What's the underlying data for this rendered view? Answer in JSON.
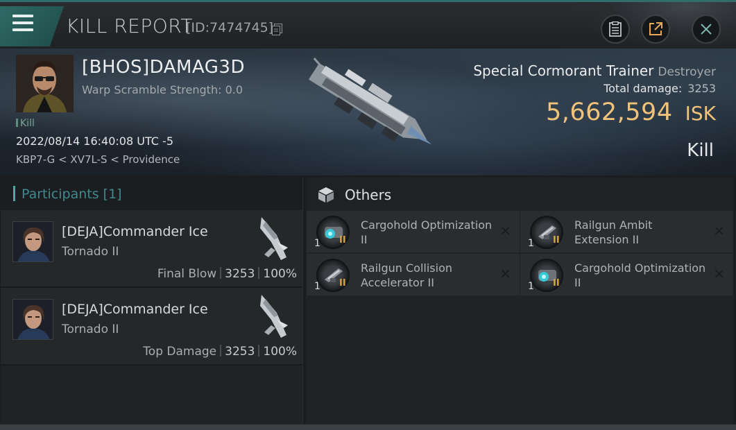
{
  "header": {
    "title": "KILL REPORT",
    "id_text": "[ID:7474745]"
  },
  "victim": {
    "name": "[BHOS]DAMAG3D",
    "warp_scramble": "Warp Scramble Strength: 0.0",
    "tag": "Kill",
    "datetime": "2022/08/14 16:40:08 UTC -5",
    "location": "KBP7-G < XV7L-S < Providence",
    "ship_name": "Special Cormorant Trainer",
    "ship_class": "Destroyer",
    "total_damage_label": "Total damage:",
    "total_damage": "3253",
    "isk_value": "5,662,594",
    "isk_unit": "ISK",
    "result": "Kill"
  },
  "participants": {
    "label": "Participants",
    "count": "[1]",
    "rows": [
      {
        "name": "[DEJA]Commander Ice",
        "ship": "Tornado II",
        "role": "Final Blow",
        "damage": "3253",
        "percent": "100%"
      },
      {
        "name": "[DEJA]Commander Ice",
        "ship": "Tornado II",
        "role": "Top Damage",
        "damage": "3253",
        "percent": "100%"
      }
    ]
  },
  "others": {
    "label": "Others",
    "items": [
      {
        "qty": "1",
        "tech": "II",
        "name": "Cargohold Optimization II",
        "close": "✕",
        "icon": "cargohold-rig-icon"
      },
      {
        "qty": "1",
        "tech": "II",
        "name": "Railgun Ambit Extension II",
        "close": "✕",
        "icon": "railgun-rig-icon"
      },
      {
        "qty": "1",
        "tech": "II",
        "name": "Railgun Collision Accelerator II",
        "close": "✕",
        "icon": "railgun-rig-icon"
      },
      {
        "qty": "1",
        "tech": "II",
        "name": "Cargohold Optimization II",
        "close": "✕",
        "icon": "cargohold-rig-icon"
      }
    ]
  },
  "colors": {
    "accent_teal": "#2f6a66",
    "isk_gold": "#f1c37a",
    "tech_gold": "#d9a441"
  }
}
